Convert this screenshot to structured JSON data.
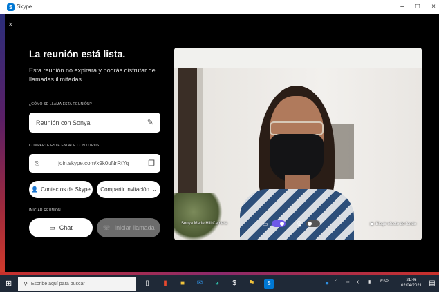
{
  "window": {
    "app_name": "Skype",
    "logo_letter": "S",
    "minimize": "–",
    "maximize": "□",
    "close": "×"
  },
  "panel": {
    "close_glyph": "×",
    "title": "La reunión está lista.",
    "description": "Esta reunión no expirará y podrás disfrutar de llamadas ilimitadas.",
    "name_label": "¿CÓMO SE LLAMA ESTA REUNIÓN?",
    "name_value": "Reunión con Sonya",
    "link_label": "COMPARTE ESTE ENLACE CON OTROS",
    "link_value": "join.skype.com/x9k0uNrRtYq",
    "contacts_button": "Contactos de Skype",
    "share_button": "Compartir invitación",
    "start_label": "INICIAR REUNIÓN",
    "chat_button": "Chat",
    "call_button": "Iniciar llamada"
  },
  "video": {
    "name_overlay": "Sonya Marie Hill Camera",
    "background_button": "Elegir efecto de fondo",
    "camera_on": true,
    "mic_on": false
  },
  "taskbar": {
    "search_placeholder": "Escribe aquí para buscar",
    "time": "21:46",
    "date": "02/04/2021",
    "tray_lang": "ESP"
  },
  "colors": {
    "accent": "#6e59e8",
    "app_bg": "#000000",
    "taskbar_bg": "#1f2937"
  }
}
